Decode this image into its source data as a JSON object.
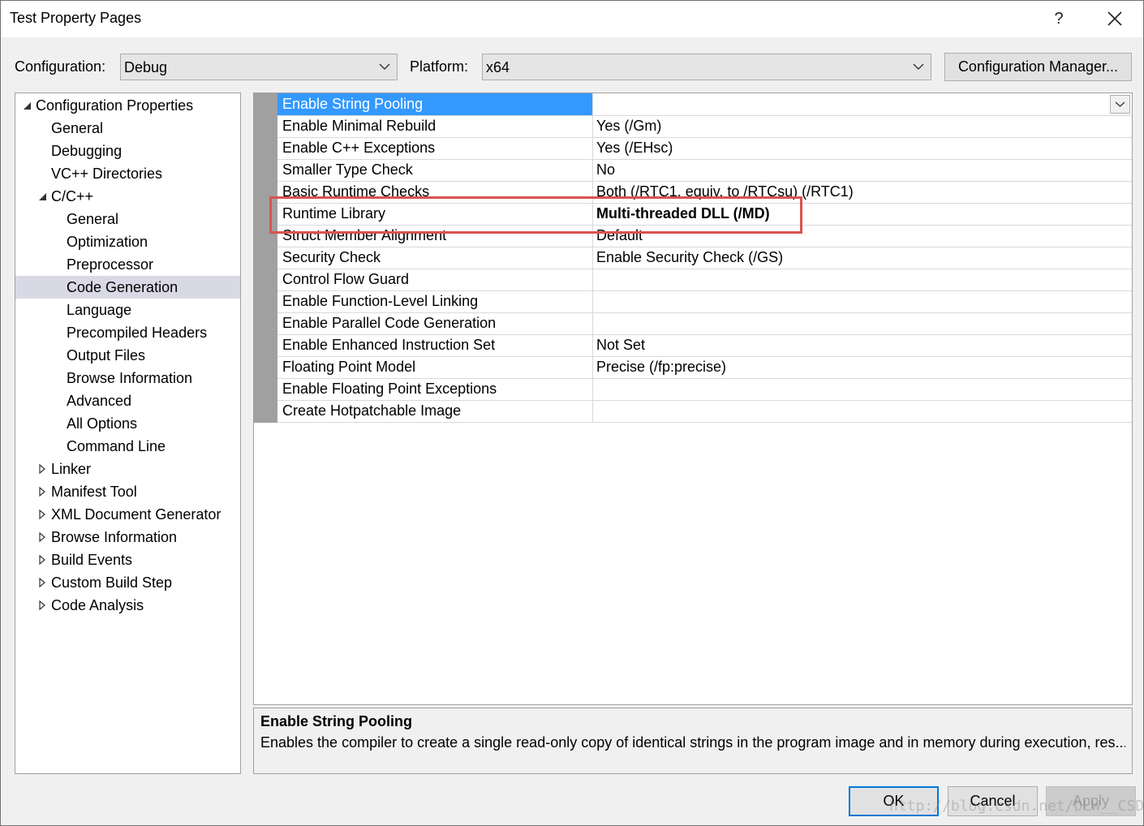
{
  "window": {
    "title": "Test Property Pages",
    "help_label": "?"
  },
  "toolbar": {
    "configuration_label": "Configuration:",
    "configuration_value": "Debug",
    "platform_label": "Platform:",
    "platform_value": "x64",
    "config_manager_label": "Configuration Manager..."
  },
  "tree": {
    "items": [
      {
        "label": "Configuration Properties",
        "level": 0,
        "state": "expanded"
      },
      {
        "label": "General",
        "level": 1,
        "state": "leaf"
      },
      {
        "label": "Debugging",
        "level": 1,
        "state": "leaf"
      },
      {
        "label": "VC++ Directories",
        "level": 1,
        "state": "leaf"
      },
      {
        "label": "C/C++",
        "level": 1,
        "state": "expanded"
      },
      {
        "label": "General",
        "level": 2,
        "state": "leaf"
      },
      {
        "label": "Optimization",
        "level": 2,
        "state": "leaf"
      },
      {
        "label": "Preprocessor",
        "level": 2,
        "state": "leaf"
      },
      {
        "label": "Code Generation",
        "level": 2,
        "state": "leaf",
        "selected": true
      },
      {
        "label": "Language",
        "level": 2,
        "state": "leaf"
      },
      {
        "label": "Precompiled Headers",
        "level": 2,
        "state": "leaf"
      },
      {
        "label": "Output Files",
        "level": 2,
        "state": "leaf"
      },
      {
        "label": "Browse Information",
        "level": 2,
        "state": "leaf"
      },
      {
        "label": "Advanced",
        "level": 2,
        "state": "leaf"
      },
      {
        "label": "All Options",
        "level": 2,
        "state": "leaf"
      },
      {
        "label": "Command Line",
        "level": 2,
        "state": "leaf"
      },
      {
        "label": "Linker",
        "level": 1,
        "state": "collapsed"
      },
      {
        "label": "Manifest Tool",
        "level": 1,
        "state": "collapsed"
      },
      {
        "label": "XML Document Generator",
        "level": 1,
        "state": "collapsed"
      },
      {
        "label": "Browse Information",
        "level": 1,
        "state": "collapsed"
      },
      {
        "label": "Build Events",
        "level": 1,
        "state": "collapsed"
      },
      {
        "label": "Custom Build Step",
        "level": 1,
        "state": "collapsed"
      },
      {
        "label": "Code Analysis",
        "level": 1,
        "state": "collapsed"
      }
    ]
  },
  "grid": {
    "rows": [
      {
        "name": "Enable String Pooling",
        "value": "",
        "selected": true
      },
      {
        "name": "Enable Minimal Rebuild",
        "value": "Yes (/Gm)"
      },
      {
        "name": "Enable C++ Exceptions",
        "value": "Yes (/EHsc)"
      },
      {
        "name": "Smaller Type Check",
        "value": "No"
      },
      {
        "name": "Basic Runtime Checks",
        "value": "Both (/RTC1, equiv. to /RTCsu) (/RTC1)"
      },
      {
        "name": "Runtime Library",
        "value": "Multi-threaded DLL (/MD)",
        "bold": true,
        "highlighted": true
      },
      {
        "name": "Struct Member Alignment",
        "value": "Default"
      },
      {
        "name": "Security Check",
        "value": "Enable Security Check (/GS)"
      },
      {
        "name": "Control Flow Guard",
        "value": ""
      },
      {
        "name": "Enable Function-Level Linking",
        "value": ""
      },
      {
        "name": "Enable Parallel Code Generation",
        "value": ""
      },
      {
        "name": "Enable Enhanced Instruction Set",
        "value": "Not Set"
      },
      {
        "name": "Floating Point Model",
        "value": "Precise (/fp:precise)"
      },
      {
        "name": "Enable Floating Point Exceptions",
        "value": ""
      },
      {
        "name": "Create Hotpatchable Image",
        "value": ""
      }
    ]
  },
  "description": {
    "title": "Enable String Pooling",
    "text": "Enables the compiler to create a single read-only copy of identical strings in the program image and in memory during execution, res..."
  },
  "buttons": {
    "ok": "OK",
    "cancel": "Cancel",
    "apply": "Apply"
  },
  "watermark": "http://blog.csdn.net/DLW__CSDN",
  "colors": {
    "selected_row": "#3399ff",
    "highlight_box": "#d9534f",
    "selected_tree": "#d9d9e6",
    "default_button_border": "#0078d7"
  }
}
